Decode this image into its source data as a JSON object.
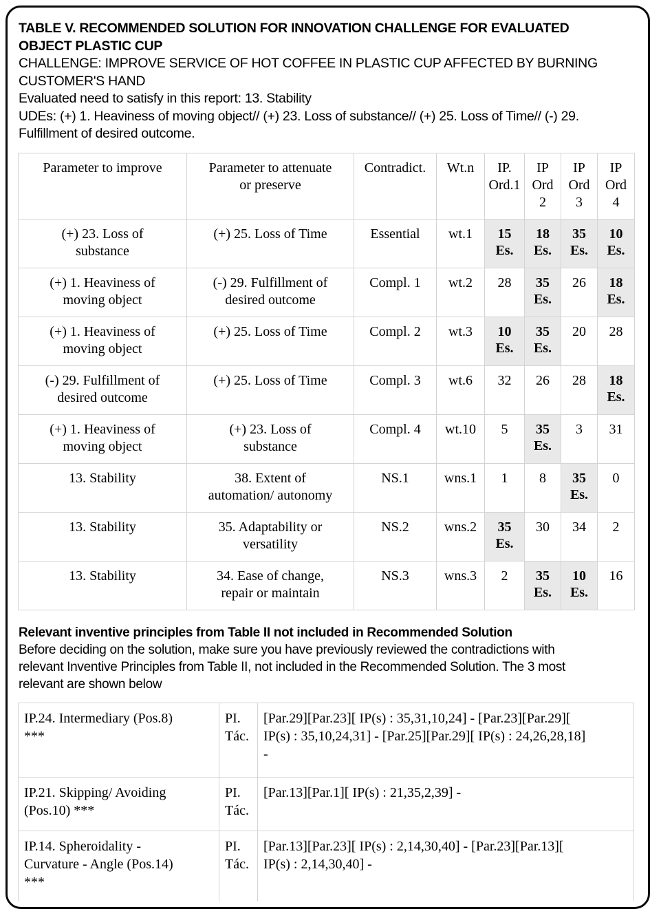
{
  "heading": {
    "title_line1": "TABLE V. RECOMMENDED SOLUTION FOR INNOVATION CHALLENGE FOR EVALUATED",
    "title_line2": "OBJECT PLASTIC CUP",
    "challenge_line1": "CHALLENGE: IMPROVE SERVICE OF HOT COFFEE IN PLASTIC CUP AFFECTED BY BURNING",
    "challenge_line2": "CUSTOMER'S HAND",
    "evaluated_need": "Evaluated need to satisfy in this report: 13. Stability",
    "udes_line1": "UDEs: (+) 1. Heaviness of moving object// (+) 23. Loss of substance// (+) 25. Loss of Time// (-) 29.",
    "udes_line2": "Fulfillment of desired outcome."
  },
  "main_table": {
    "headers": {
      "improve": "Parameter to improve",
      "attenuate_l1": "Parameter to attenuate",
      "attenuate_l2": "or preserve",
      "contradict": "Contradict.",
      "wt": "Wt.n",
      "ord1_l1": "IP.",
      "ord1_l2": "Ord.1",
      "ord2_l1": "IP",
      "ord2_l2": "Ord",
      "ord2_l3": "2",
      "ord3_l1": "IP",
      "ord3_l2": "Ord",
      "ord3_l3": "3",
      "ord4_l1": "IP",
      "ord4_l2": "Ord",
      "ord4_l3": "4"
    },
    "es_label": "Es.",
    "rows": [
      {
        "improve_l1": "(+) 23. Loss of",
        "improve_l2": "substance",
        "attenuate_l1": "(+) 25. Loss of Time",
        "attenuate_l2": "",
        "contradict": "Essential",
        "wt": "wt.1",
        "ord1": "15",
        "ord1_hl": true,
        "ord2": "18",
        "ord2_hl": true,
        "ord3": "35",
        "ord3_hl": true,
        "ord4": "10",
        "ord4_hl": true
      },
      {
        "improve_l1": "(+) 1. Heaviness of",
        "improve_l2": "moving object",
        "attenuate_l1": "(-) 29. Fulfillment of",
        "attenuate_l2": "desired outcome",
        "contradict": "Compl. 1",
        "wt": "wt.2",
        "ord1": "28",
        "ord1_hl": false,
        "ord2": "35",
        "ord2_hl": true,
        "ord3": "26",
        "ord3_hl": false,
        "ord4": "18",
        "ord4_hl": true
      },
      {
        "improve_l1": "(+) 1. Heaviness of",
        "improve_l2": "moving object",
        "attenuate_l1": "(+) 25. Loss of Time",
        "attenuate_l2": "",
        "contradict": "Compl. 2",
        "wt": "wt.3",
        "ord1": "10",
        "ord1_hl": true,
        "ord2": "35",
        "ord2_hl": true,
        "ord3": "20",
        "ord3_hl": false,
        "ord4": "28",
        "ord4_hl": false
      },
      {
        "improve_l1": "(-) 29. Fulfillment of",
        "improve_l2": "desired outcome",
        "attenuate_l1": "(+) 25. Loss of Time",
        "attenuate_l2": "",
        "contradict": "Compl. 3",
        "wt": "wt.6",
        "ord1": "32",
        "ord1_hl": false,
        "ord2": "26",
        "ord2_hl": false,
        "ord3": "28",
        "ord3_hl": false,
        "ord4": "18",
        "ord4_hl": true
      },
      {
        "improve_l1": "(+) 1. Heaviness of",
        "improve_l2": "moving object",
        "attenuate_l1": "(+) 23. Loss of",
        "attenuate_l2": "substance",
        "contradict": "Compl. 4",
        "wt": "wt.10",
        "ord1": "5",
        "ord1_hl": false,
        "ord2": "35",
        "ord2_hl": true,
        "ord3": "3",
        "ord3_hl": false,
        "ord4": "31",
        "ord4_hl": false
      },
      {
        "improve_l1": "13. Stability",
        "improve_l2": "",
        "attenuate_l1": "38. Extent of",
        "attenuate_l2": "automation/ autonomy",
        "contradict": "NS.1",
        "wt": "wns.1",
        "ord1": "1",
        "ord1_hl": false,
        "ord2": "8",
        "ord2_hl": false,
        "ord3": "35",
        "ord3_hl": true,
        "ord4": "0",
        "ord4_hl": false
      },
      {
        "improve_l1": "13. Stability",
        "improve_l2": "",
        "attenuate_l1": "35. Adaptability or",
        "attenuate_l2": "versatility",
        "contradict": "NS.2",
        "wt": "wns.2",
        "ord1": "35",
        "ord1_hl": true,
        "ord2": "30",
        "ord2_hl": false,
        "ord3": "34",
        "ord3_hl": false,
        "ord4": "2",
        "ord4_hl": false
      },
      {
        "improve_l1": "13. Stability",
        "improve_l2": "",
        "attenuate_l1": "34. Ease of change,",
        "attenuate_l2": "repair or maintain",
        "contradict": "NS.3",
        "wt": "wns.3",
        "ord1": "2",
        "ord1_hl": false,
        "ord2": "35",
        "ord2_hl": true,
        "ord3": "10",
        "ord3_hl": true,
        "ord4": "16",
        "ord4_hl": false
      }
    ]
  },
  "mid_text": {
    "bold_heading": "Relevant inventive principles from Table II not included in Recommended Solution",
    "para_l1": "Before deciding on the solution, make sure you have previously reviewed the contradictions with",
    "para_l2": "relevant Inventive Principles from Table II, not included in the Recommended Solution. The 3 most",
    "para_l3": "relevant are shown below"
  },
  "principles_table": {
    "rows": [
      {
        "name_l1": "IP.24. Intermediary (Pos.8)",
        "name_l2": "***",
        "name_l3": "",
        "tac_l1": "PI.",
        "tac_l2": "Tác.",
        "body_l1": "[Par.29][Par.23][ IP(s) : 35,31,10,24] - [Par.23][Par.29][",
        "body_l2": "IP(s) : 35,10,24,31] - [Par.25][Par.29][ IP(s) : 24,26,28,18]",
        "body_l3": "-"
      },
      {
        "name_l1": "IP.21. Skipping/ Avoiding",
        "name_l2": "(Pos.10) ***",
        "name_l3": "",
        "tac_l1": "PI.",
        "tac_l2": "Tác.",
        "body_l1": "[Par.13][Par.1][ IP(s) : 21,35,2,39] -",
        "body_l2": "",
        "body_l3": ""
      },
      {
        "name_l1": "IP.14. Spheroidality -",
        "name_l2": "Curvature - Angle (Pos.14)",
        "name_l3": "***",
        "tac_l1": "PI.",
        "tac_l2": "Tác.",
        "body_l1": "[Par.13][Par.23][ IP(s) : 2,14,30,40] - [Par.23][Par.13][",
        "body_l2": "IP(s) : 2,14,30,40] -",
        "body_l3": ""
      }
    ]
  },
  "colors": {
    "highlight_bg": "#e9e9e9",
    "grid_line": "#d4d4d4",
    "frame_border": "#0a0a0a",
    "text": "#000000"
  }
}
